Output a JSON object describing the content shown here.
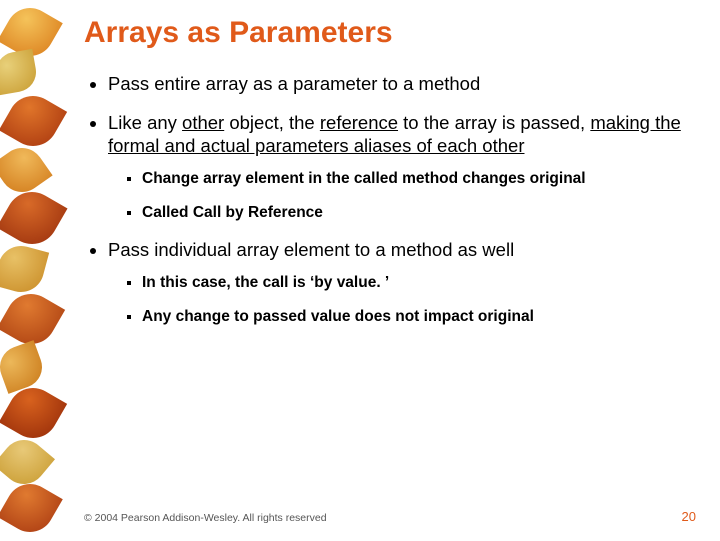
{
  "title": "Arrays as Parameters",
  "bullets": {
    "b1": "Pass entire array as a parameter to a method",
    "b2": {
      "t1": "Like any ",
      "u1": "other",
      "t2": " object, the ",
      "u2": "reference",
      "t3": " to the array is passed, ",
      "u3": "making the formal and actual parameters aliases of each other"
    },
    "b2_sub1": "Change array element in the called method changes original",
    "b2_sub2": "Called Call by Reference",
    "b3": "Pass individual array element to  a method as well",
    "b3_sub1": "In this case, the call is ‘by value. ’",
    "b3_sub2": "Any change to passed value does not impact original"
  },
  "footer": {
    "copyright": "© 2004 Pearson Addison-Wesley. All rights reserved",
    "page": "20"
  }
}
